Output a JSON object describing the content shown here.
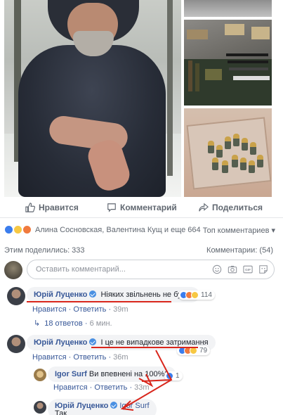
{
  "actions": {
    "like_label": "Нравится",
    "comment_label": "Комментарий",
    "share_label": "Поделиться"
  },
  "reactions": {
    "names": "Алина Сосновская, Валентина Кущ и еще 664",
    "sort_label": "Топ комментариев ▾"
  },
  "stats": {
    "shares": "Этим поделились: 333",
    "comments": "Комментарии: (54)"
  },
  "composer": {
    "placeholder": "Оставить комментарий..."
  },
  "comments": [
    {
      "author": "Юрій Луценко",
      "text": "Ніяких звільнень не буде.",
      "like": "Нравится",
      "reply": "Ответить",
      "time": "39m",
      "reaction_count": "114"
    },
    {
      "author": "Юрій Луценко",
      "text": "І це не випадкове затримання",
      "like": "Нравится",
      "reply": "Ответить",
      "time": "36m",
      "reaction_count": "79"
    }
  ],
  "replies_link": {
    "label": "18 ответов",
    "time": "6 мин."
  },
  "replies": [
    {
      "author": "Igor Surf",
      "text": "Ви впевнені на 100%?",
      "like": "Нравится",
      "reply": "Ответить",
      "time": "33m",
      "reaction_count": "1"
    },
    {
      "author": "Юрій Луценко",
      "mention": "Igor Surf",
      "text": "Так"
    }
  ],
  "separator": "·",
  "colors": {
    "link": "#385898",
    "muted": "#90949c",
    "annotation": "#d9261c",
    "like": "#3b7ded"
  },
  "icons": {
    "like": "thumbs-up-icon",
    "comment": "speech-bubble-icon",
    "share": "share-arrow-icon",
    "emoji": "smiley-icon",
    "camera": "camera-icon",
    "gif": "gif-icon",
    "sticker": "sticker-icon"
  }
}
